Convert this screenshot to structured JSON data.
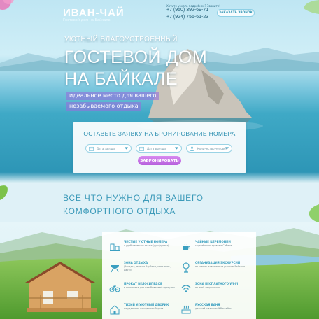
{
  "header": {
    "logo": "ИВАН-ЧАЙ",
    "logo_sub": "Гостевой дом на Байкале",
    "contact_note": "Хотите узнать подробнее? Звоните!",
    "phones": [
      "+7 (950) 392-69-71",
      "+7 (924) 756-61-23"
    ],
    "call_button": "ЗАКАЗАТЬ ЗВОНОК"
  },
  "hero": {
    "tagline": "УЮТНЫЙ БЛАГОУСТРОЕННЫЙ",
    "title_line1": "ГОСТЕВОЙ ДОМ",
    "title_line2": "НА БАЙКАЛЕ",
    "pill1": "идеальное место для вашего",
    "pill2": "незабываемого отдыха"
  },
  "booking": {
    "title": "ОСТАВЬТЕ ЗАЯВКУ НА БРОНИРОВАНИЕ НОМЕРА",
    "checkin": "Дата заезда",
    "checkout": "Дата выезда",
    "people": "Количество человек",
    "button": "ЗАБРОНИРОВАТЬ"
  },
  "section": {
    "title_line1": "ВСЕ ЧТО НУЖНО ДЛЯ ВАШЕГО",
    "title_line2": "КОМФОРТНОГО ОТДЫХА"
  },
  "features": [
    {
      "title": "ЧИСТЫЕ УЮТНЫЕ НОМЕРА",
      "desc": "с удобствами на этаже (душ/туалет)",
      "icon": "rooms-icon"
    },
    {
      "title": "ЧАЙНЫЕ ЦЕРЕМОНИИ",
      "desc": "с целебными травами Сибири",
      "icon": "tea-icon"
    },
    {
      "title": "ЗОНА ОТДЫХА",
      "desc": "(беседка, мангал-барбекю, пинг-понг, дартс)",
      "icon": "grill-icon"
    },
    {
      "title": "ОРГАНИЗАЦИЯ ЭКСКУРСИЙ",
      "desc": "по самым живописным уголкам Байкала",
      "icon": "excursion-icon"
    },
    {
      "title": "ПРОКАТ ВЕЛОСИПЕДОВ",
      "desc": "в комплекте для незабываемой прогулки",
      "icon": "bicycle-icon"
    },
    {
      "title": "ЗОНА БЕСПЛАТНОГО WI-FI",
      "desc": "по всей территории",
      "icon": "wifi-icon"
    },
    {
      "title": "ТИХИЙ И УЮТНЫЙ ДВОРИК",
      "desc": "на удалении от шумного берега",
      "icon": "yard-icon"
    },
    {
      "title": "РУССКАЯ БАНЯ",
      "desc": "детский и взрослый бассейны",
      "icon": "sauna-icon"
    }
  ],
  "colors": {
    "accent": "#3a9fc0",
    "button": "#c46fe4",
    "pill": "#9a6edc"
  }
}
